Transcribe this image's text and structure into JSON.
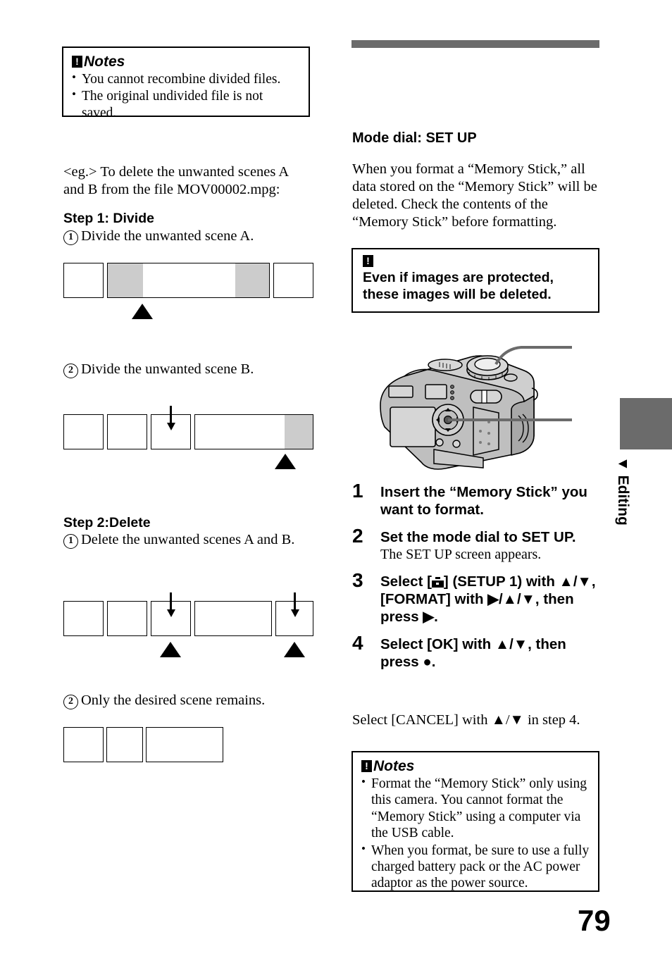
{
  "page": {
    "number": "79",
    "side_tab": {
      "marker": "▼",
      "label": "Editing"
    }
  },
  "left_column": {
    "notes_box": {
      "icon": "caution-icon",
      "title": "Notes",
      "items": [
        "You cannot recombine divided files.",
        "The original undivided file is not saved."
      ]
    },
    "example_text": "<eg.> To delete the unwanted scenes A and B from the file MOV00002.mpg:",
    "step1": {
      "heading": "Step 1: Divide",
      "item1_num": "1",
      "item1_text": "Divide the unwanted scene A.",
      "item2_num": "2",
      "item2_text": "Divide the unwanted scene B."
    },
    "step2": {
      "heading": "Step 2:Delete",
      "item1_num": "1",
      "item1_text": "Delete the unwanted scenes A and B.",
      "item2_num": "2",
      "item2_text": "Only the desired scene remains."
    }
  },
  "right_column": {
    "section_title": "Mode dial: SET UP",
    "intro": "When you format a “Memory Stick,” all data stored on the “Memory Stick” will be deleted. Check the contents of the “Memory Stick” before formatting.",
    "caution_box": {
      "icon": "caution-icon",
      "text": "Even if images are protected, these images will be deleted."
    },
    "figure": {
      "name": "camera-rear-illustration",
      "callouts": [
        "mode-dial",
        "control-button"
      ]
    },
    "steps": [
      {
        "num": "1",
        "main": "Insert the “Memory Stick” you want to format.",
        "sub": ""
      },
      {
        "num": "2",
        "main": "Set the mode dial to SET UP.",
        "sub": "The SET UP screen appears."
      },
      {
        "num": "3",
        "main_prefix": "Select [",
        "main_mid": "] (SETUP 1) with ▲/▼, [FORMAT] with ▶/▲/▼, then press ▶.",
        "sub": ""
      },
      {
        "num": "4",
        "main": "Select [OK] with ▲/▼, then press ●.",
        "sub": ""
      }
    ],
    "cancel_text": "Select [CANCEL] with ▲/▼ in step 4.",
    "cancel_step_ref": "4",
    "notes_box": {
      "icon": "caution-icon",
      "title": "Notes",
      "items": [
        "Format the “Memory Stick” only using this camera. You cannot format the “Memory Stick” using a computer via the USB cable.",
        "When you format, be sure to use a fully charged battery pack or the AC power adaptor as the power source."
      ]
    }
  },
  "colors": {
    "bar_gray": "#6b6b6b",
    "segment_gray": "#cccccc",
    "ink": "#000000"
  }
}
